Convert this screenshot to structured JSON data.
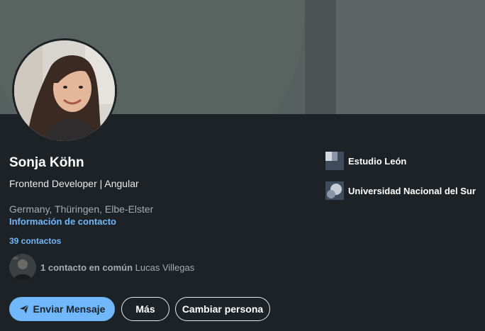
{
  "profile": {
    "name": "Sonja Köhn",
    "headline": "Frontend Developer | Angular",
    "location": "Germany, Thüringen, Elbe-Elster",
    "contact_info_label": "Información de contacto",
    "contacts_count": "39 contactos",
    "mutual": {
      "count_text": "1 contacto en común",
      "name": "Lucas Villegas"
    }
  },
  "actions": {
    "send_message": "Enviar Mensaje",
    "more": "Más",
    "change_person": "Cambiar persona"
  },
  "experience": [
    {
      "name": "Estudio León",
      "icon": "company-logo"
    },
    {
      "name": "Universidad Nacional del Sur",
      "icon": "university-logo"
    }
  ],
  "colors": {
    "background": "#1d2226",
    "banner": "#56605f",
    "accent": "#71b7fb"
  }
}
